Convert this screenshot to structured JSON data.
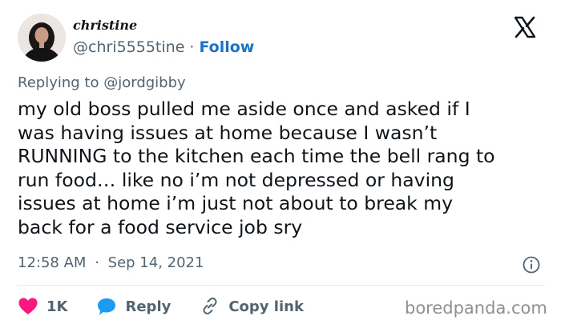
{
  "author": {
    "display_name": "christine",
    "handle": "@chri5555tine",
    "separator": "·",
    "follow_label": "Follow"
  },
  "reply_context": {
    "prefix": "Replying to",
    "mention": "@jordgibby"
  },
  "tweet": {
    "lines": [
      "my old boss pulled me aside once and asked if I",
      "was having issues at home because I wasn’t",
      "RUNNING to the kitchen each time the bell rang to",
      "run food… like no i’m not depressed or having",
      "issues at home i’m just not about to break my",
      "back for a food service job sry"
    ],
    "time": "12:58 AM",
    "separator": "·",
    "date": "Sep 14, 2021"
  },
  "actions": {
    "like_count": "1K",
    "reply_label": "Reply",
    "copy_link_label": "Copy link"
  },
  "watermark": "boredpanda.com",
  "colors": {
    "text": "#0f1419",
    "muted": "#536471",
    "follow": "#1d72c4",
    "like": "#f91880",
    "reply": "#1d9bf0",
    "divider": "#e7ebee"
  },
  "icons": [
    "x-logo-icon",
    "heart-icon",
    "reply-bubble-icon",
    "link-icon",
    "info-icon"
  ]
}
